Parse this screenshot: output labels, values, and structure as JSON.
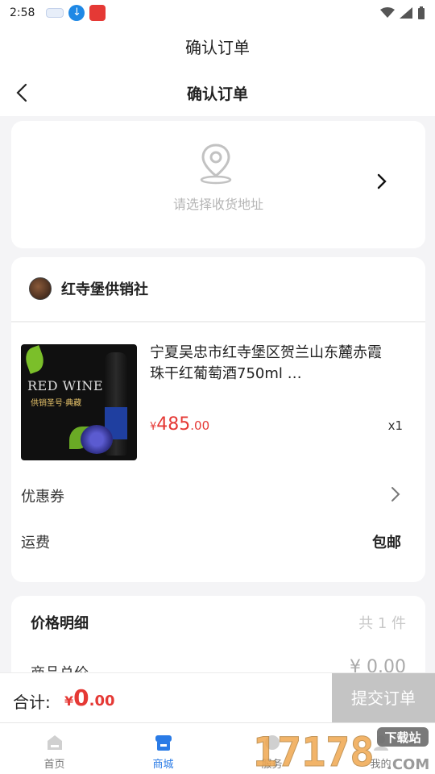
{
  "status_bar": {
    "time": "2:58",
    "download_icon": "↓"
  },
  "window": {
    "title": "确认订单"
  },
  "nav": {
    "title": "确认订单"
  },
  "address": {
    "placeholder": "请选择收货地址"
  },
  "shop": {
    "name": "红寺堡供销社",
    "product": {
      "title": "宁夏吴忠市红寺堡区贺兰山东麓赤霞珠干红葡萄酒750ml …",
      "image_text_1": "RED WINE",
      "image_text_2": "供销圣号·典藏",
      "price_currency": "¥",
      "price_int": "485",
      "price_dec": ".00",
      "quantity": "x1"
    },
    "coupon_label": "优惠券",
    "shipping_label": "运费",
    "shipping_value": "包邮"
  },
  "price_detail": {
    "title": "价格明细",
    "count": "共 1 件",
    "total_label": "商品总价",
    "total_value": "¥ 0.00"
  },
  "footer": {
    "total_label": "合计:",
    "currency": "¥",
    "total_int": "0",
    "total_dec": ".00",
    "submit_label": "提交订单"
  },
  "tabs": [
    {
      "label": "首页",
      "icon": "home-icon",
      "active": false
    },
    {
      "label": "商城",
      "icon": "shop-icon",
      "active": true
    },
    {
      "label": "服务",
      "icon": "service-icon",
      "active": false
    },
    {
      "label": "我的",
      "icon": "profile-icon",
      "active": false
    }
  ],
  "watermark": {
    "number": "17178",
    "badge": "下载站",
    "domain": ".COM"
  },
  "colors": {
    "accent": "#e53935",
    "tab_active": "#2a7be6",
    "button_disabled": "#c4c4c4"
  }
}
